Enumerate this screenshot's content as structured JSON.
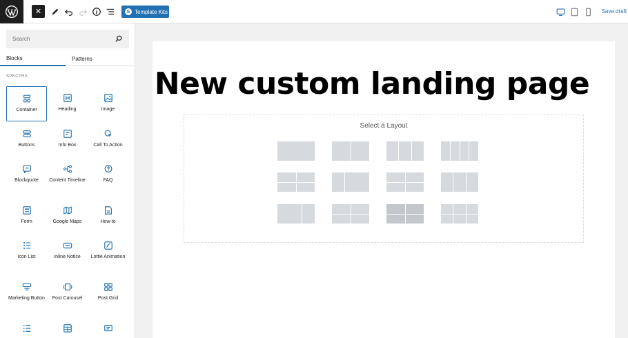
{
  "toolbar": {
    "template_kits_label": "Template Kits",
    "save_draft_label": "Save draft",
    "close_symbol": "✕",
    "template_kits_badge": "S"
  },
  "sidebar": {
    "search_placeholder": "Search",
    "tabs": [
      "Blocks",
      "Patterns"
    ],
    "category": "SPECTRA",
    "blocks": [
      {
        "label": "Container",
        "icon": "container-icon"
      },
      {
        "label": "Heading",
        "icon": "heading-icon"
      },
      {
        "label": "Image",
        "icon": "image-icon"
      },
      {
        "label": "Buttons",
        "icon": "buttons-icon"
      },
      {
        "label": "Info Box",
        "icon": "info-box-icon"
      },
      {
        "label": "Call To Action",
        "icon": "call-to-action-icon"
      },
      {
        "label": "Blockquote",
        "icon": "blockquote-icon"
      },
      {
        "label": "Content Timeline",
        "icon": "content-timeline-icon"
      },
      {
        "label": "FAQ",
        "icon": "faq-icon"
      },
      {
        "label": "Form",
        "icon": "form-icon"
      },
      {
        "label": "Google Maps",
        "icon": "google-maps-icon"
      },
      {
        "label": "How-to",
        "icon": "how-to-icon"
      },
      {
        "label": "Icon List",
        "icon": "icon-list-icon"
      },
      {
        "label": "Inline Notice",
        "icon": "inline-notice-icon"
      },
      {
        "label": "Lottie Animation",
        "icon": "lottie-animation-icon"
      },
      {
        "label": "Marketing Button",
        "icon": "marketing-button-icon"
      },
      {
        "label": "Post Carousel",
        "icon": "post-carousel-icon"
      },
      {
        "label": "Post Grid",
        "icon": "post-grid-icon"
      },
      {
        "label": "",
        "icon": "list-icon"
      },
      {
        "label": "",
        "icon": "table-icon"
      },
      {
        "label": "",
        "icon": "review-icon"
      }
    ]
  },
  "canvas": {
    "title": "New custom landing page",
    "layout_title": "Select a Layout"
  },
  "colors": {
    "accent": "#2271b1",
    "dark": "#1e1e1e"
  }
}
